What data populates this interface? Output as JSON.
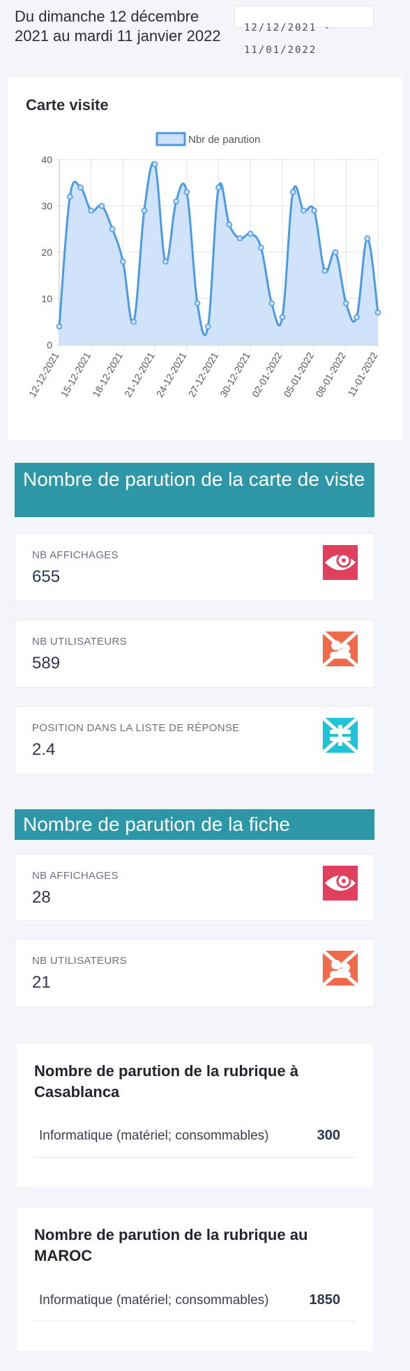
{
  "header": {
    "period_text": "Du dimanche 12 décembre 2021 au mardi 11 janvier 2022",
    "date_range_value": "12/12/2021 - 11/01/2022"
  },
  "chart_card": {
    "title": "Carte visite"
  },
  "chart_data": {
    "type": "area",
    "legend": "Nbr de parution",
    "legend_position": "top",
    "grid": true,
    "ylim": [
      0,
      40
    ],
    "y_ticks": [
      "0",
      "10",
      "20",
      "30",
      "40"
    ],
    "x_tick_labels": [
      "12-12-2021",
      "15-12-2021",
      "18-12-2021",
      "21-12-2021",
      "24-12-2021",
      "27-12-2021",
      "30-12-2021",
      "02-01-2022",
      "05-01-2022",
      "08-01-2022",
      "11-01-2022"
    ],
    "x": [
      "12-12-2021",
      "13-12-2021",
      "14-12-2021",
      "15-12-2021",
      "16-12-2021",
      "17-12-2021",
      "18-12-2021",
      "19-12-2021",
      "20-12-2021",
      "21-12-2021",
      "22-12-2021",
      "23-12-2021",
      "24-12-2021",
      "25-12-2021",
      "26-12-2021",
      "27-12-2021",
      "28-12-2021",
      "29-12-2021",
      "30-12-2021",
      "31-12-2021",
      "01-01-2022",
      "02-01-2022",
      "03-01-2022",
      "04-01-2022",
      "05-01-2022",
      "06-01-2022",
      "07-01-2022",
      "08-01-2022",
      "09-01-2022",
      "10-01-2022",
      "11-01-2022"
    ],
    "series": [
      {
        "name": "Nbr de parution",
        "values": [
          4,
          32,
          34,
          29,
          30,
          25,
          18,
          5,
          29,
          39,
          18,
          31,
          33,
          9,
          4,
          34,
          26,
          23,
          24,
          21,
          9,
          6,
          33,
          29,
          29,
          16,
          20,
          9,
          6,
          23,
          7
        ]
      }
    ],
    "colors": {
      "line": "#4a9ae6",
      "fill": "#cde2fa"
    }
  },
  "section_carte": {
    "title": "Nombre de parution de la carte de viste",
    "stats": [
      {
        "label": "NB AFFICHAGES",
        "value": "655",
        "icon": "eye-icon",
        "color": "#e0405e"
      },
      {
        "label": "NB UTILISATEURS",
        "value": "589",
        "icon": "users-icon",
        "color": "#ef6b4b"
      },
      {
        "label": "POSITION DANS LA LISTE DE RÉPONSE",
        "value": "2.4",
        "icon": "list-position-icon",
        "color": "#1fc2d6"
      }
    ]
  },
  "section_fiche": {
    "title": "Nombre de parution de la fiche",
    "stats": [
      {
        "label": "NB AFFICHAGES",
        "value": "28",
        "icon": "eye-icon",
        "color": "#e0405e"
      },
      {
        "label": "NB UTILISATEURS",
        "value": "21",
        "icon": "users-icon",
        "color": "#ef6b4b"
      }
    ]
  },
  "rubrique_casablanca": {
    "title": "Nombre de parution de la rubrique à Casablanca",
    "rows": [
      {
        "label": "Informatique (matériel; consommables)",
        "value": "300"
      }
    ]
  },
  "rubrique_maroc": {
    "title": "Nombre de parution de la rubrique au MAROC",
    "rows": [
      {
        "label": "Informatique (matériel; consommables)",
        "value": "1850"
      }
    ]
  }
}
